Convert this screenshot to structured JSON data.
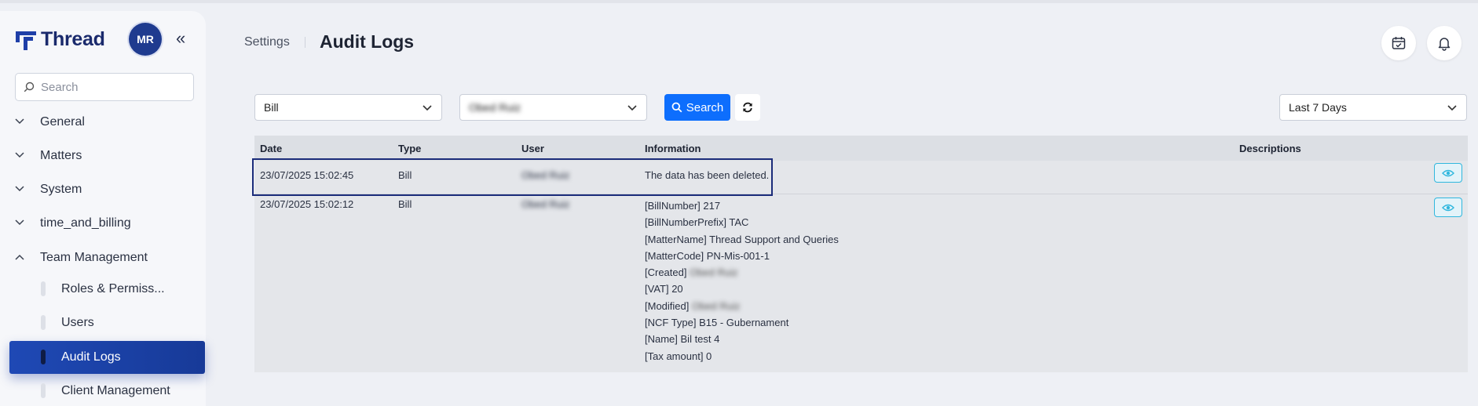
{
  "app": {
    "brand": "Thread",
    "avatar_initials": "MR"
  },
  "sidebar": {
    "search_placeholder": "Search",
    "groups": [
      {
        "label": "General",
        "expanded": false
      },
      {
        "label": "Matters",
        "expanded": false
      },
      {
        "label": "System",
        "expanded": false
      },
      {
        "label": "time_and_billing",
        "expanded": false
      },
      {
        "label": "Team Management",
        "expanded": true
      }
    ],
    "sub_items": [
      {
        "label": "Roles & Permiss...",
        "active": false
      },
      {
        "label": "Users",
        "active": false
      },
      {
        "label": "Audit Logs",
        "active": true
      },
      {
        "label": "Client Management",
        "active": false
      }
    ]
  },
  "header": {
    "breadcrumb_parent": "Settings",
    "title": "Audit Logs"
  },
  "filters": {
    "type_value": "Bill",
    "user_value": "Obed Ruiz",
    "search_label": "Search",
    "range_value": "Last 7 Days"
  },
  "table": {
    "columns": [
      "Date",
      "Type",
      "User",
      "Information",
      "Descriptions"
    ],
    "rows": [
      {
        "date": "23/07/2025 15:02:45",
        "type": "Bill",
        "user": "Obed Ruiz",
        "information": "The data has been deleted."
      },
      {
        "date": "23/07/2025 15:02:12",
        "type": "Bill",
        "user": "Obed Ruiz",
        "info_lines": [
          {
            "label": "[BillNumber] ",
            "value": "217"
          },
          {
            "label": "[BillNumberPrefix] ",
            "value": "TAC"
          },
          {
            "label": "[MatterName] ",
            "value": "Thread Support and Queries"
          },
          {
            "label": "[MatterCode] ",
            "value": "PN-Mis-001-1"
          },
          {
            "label": "[Created] ",
            "value": "Obed Ruiz",
            "blurred": true
          },
          {
            "label": "[VAT] ",
            "value": "20"
          },
          {
            "label": "[Modified] ",
            "value": "Obed Ruiz",
            "blurred": true
          },
          {
            "label": "[NCF Type] ",
            "value": "B15 - Gubernament"
          },
          {
            "label": "[Name] ",
            "value": "Bil test 4"
          },
          {
            "label": "[Tax amount] ",
            "value": "0"
          }
        ]
      }
    ]
  },
  "colors": {
    "primary": "#0d6efd",
    "active_nav": "#1f49b5",
    "brand": "#1a2a6c",
    "highlight_border": "#1b2c7a"
  }
}
